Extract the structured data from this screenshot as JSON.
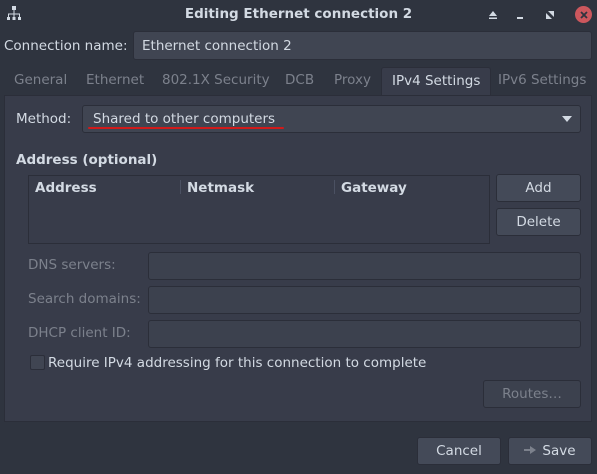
{
  "window": {
    "title": "Editing Ethernet connection 2",
    "icon": "network-wired-icon",
    "controls": [
      "shade-icon",
      "minimize-icon",
      "maximize-icon",
      "close-icon"
    ]
  },
  "connection": {
    "label": "Connection name:",
    "value": "Ethernet connection 2"
  },
  "tabs": [
    {
      "label": "General"
    },
    {
      "label": "Ethernet"
    },
    {
      "label": "802.1X Security"
    },
    {
      "label": "DCB"
    },
    {
      "label": "Proxy"
    },
    {
      "label": "IPv4 Settings",
      "active": true
    },
    {
      "label": "IPv6 Settings"
    }
  ],
  "ipv4": {
    "method_label": "Method:",
    "method_value": "Shared to other computers",
    "address_heading": "Address (optional)",
    "columns": [
      "Address",
      "Netmask",
      "Gateway"
    ],
    "add_label": "Add",
    "delete_label": "Delete",
    "dns_label": "DNS servers:",
    "search_label": "Search domains:",
    "dhcp_label": "DHCP client ID:",
    "require_label": "Require IPv4 addressing for this connection to complete",
    "require_checked": false,
    "routes_label": "Routes…"
  },
  "footer": {
    "cancel_label": "Cancel",
    "save_label": "Save"
  },
  "colors": {
    "background": "#2f343f",
    "panel": "#383c4a",
    "text": "#d3dae3",
    "disabled_text": "#7c818c",
    "close_button": "#cc575d",
    "annotation_underline": "#d11a1a"
  }
}
